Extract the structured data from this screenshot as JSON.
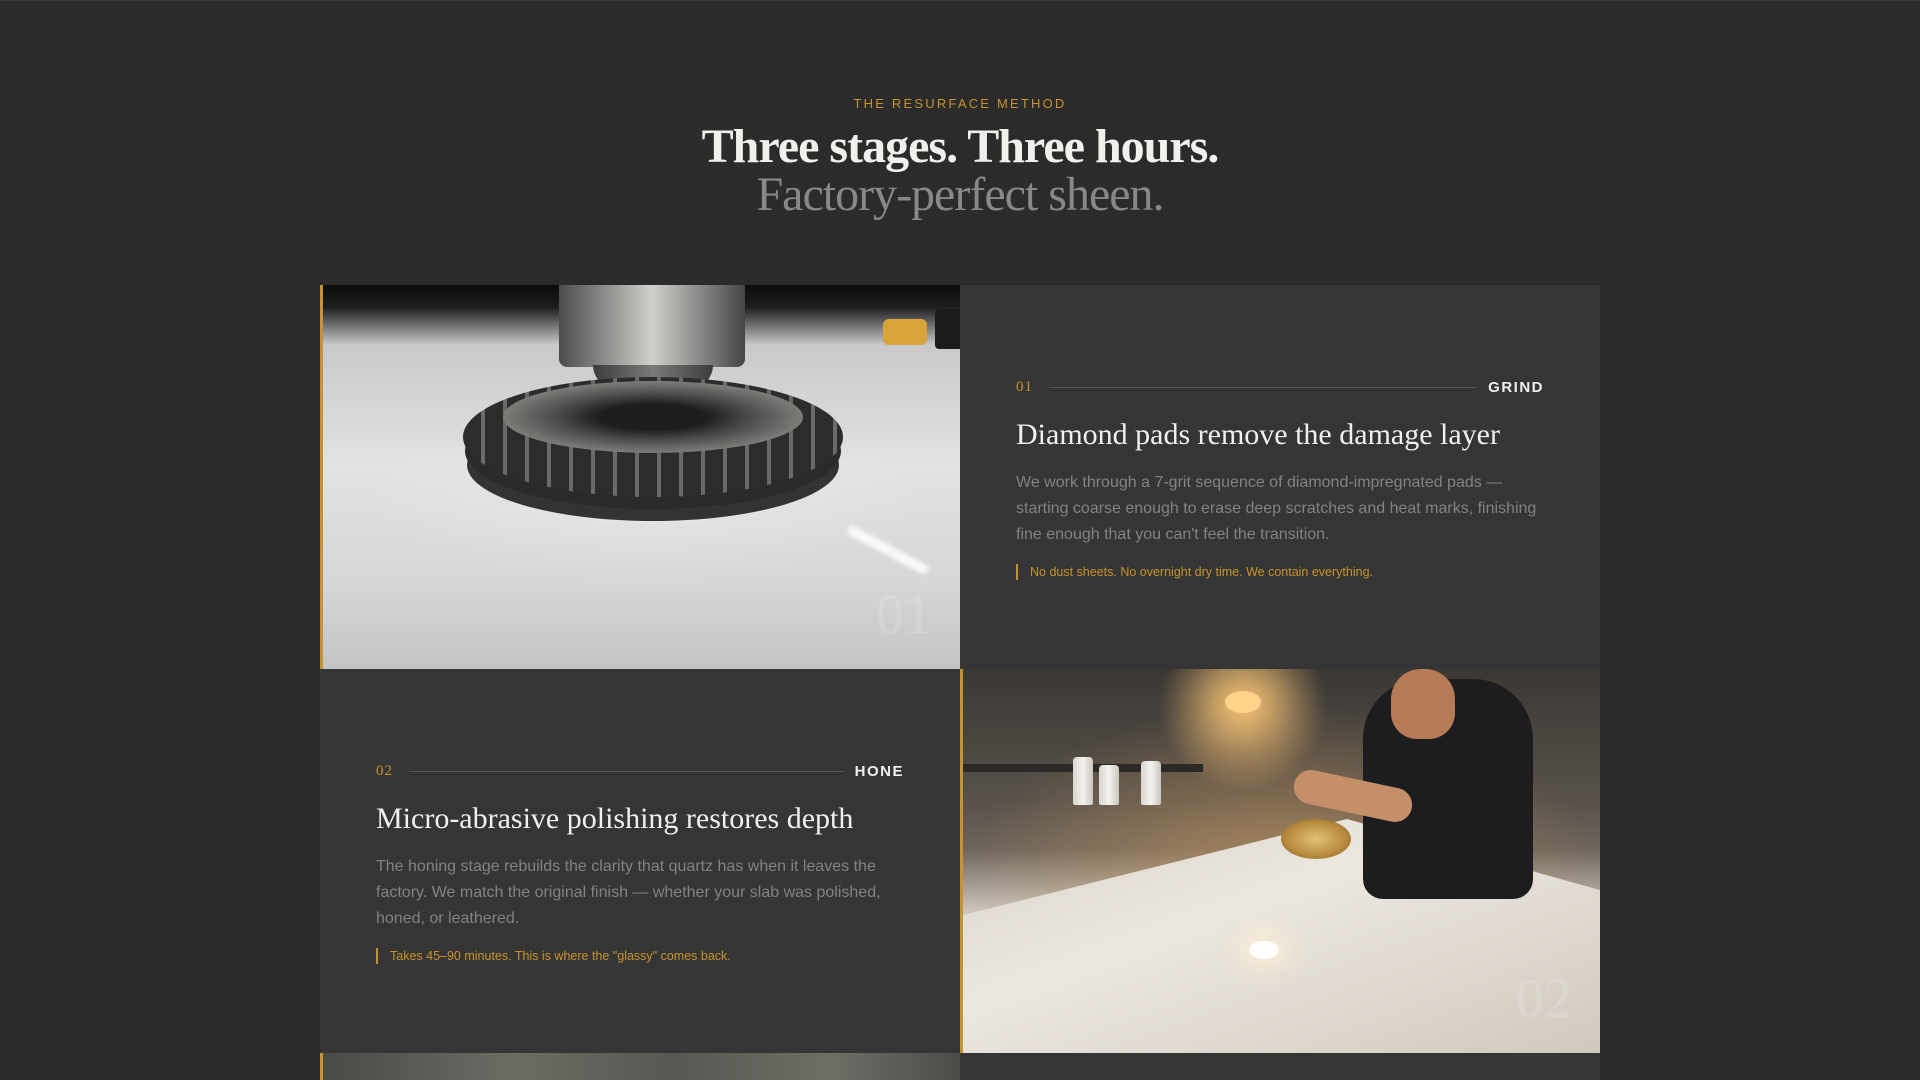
{
  "header": {
    "eyebrow": "THE RESURFACE METHOD",
    "headline": "Three stages. Three hours.",
    "subline": "Factory-perfect sheen."
  },
  "stages": [
    {
      "number": "01",
      "label": "GRIND",
      "title": "Diamond pads remove the damage layer",
      "body": "We work through a 7-grit sequence of diamond-impregnated pads — starting coarse enough to erase deep scratches and heat marks, finishing fine enough that you can't feel the transition.",
      "note": "No dust sheets. No overnight dry time. We contain everything.",
      "ghost_number": "01",
      "image": "grinding-pad-photo"
    },
    {
      "number": "02",
      "label": "HONE",
      "title": "Micro-abrasive polishing restores depth",
      "body": "The honing stage rebuilds the clarity that quartz has when it leaves the factory. We match the original finish — whether your slab was polished, honed, or leathered.",
      "note": "Takes 45–90 minutes. This is where the \"glassy\" comes back.",
      "ghost_number": "02",
      "image": "craftsman-honing-photo"
    }
  ],
  "colors": {
    "accent": "#c8932a",
    "background": "#2b2b2c",
    "panel": "#353535",
    "text": "#f2f0ec",
    "muted": "#858280"
  }
}
